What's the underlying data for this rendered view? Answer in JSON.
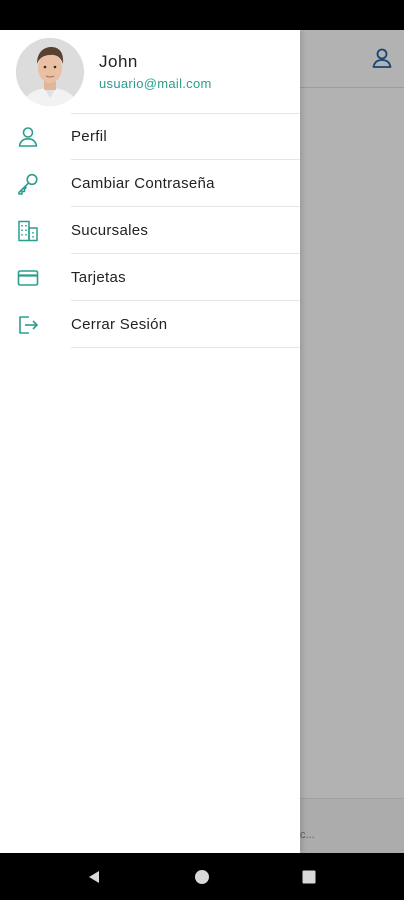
{
  "colors": {
    "accent": "#2a9d8f",
    "text": "#222222",
    "profile_icon": "#2563a8"
  },
  "user": {
    "name": "John",
    "email": "usuario@mail.com"
  },
  "menu": [
    {
      "label": "Perfil",
      "icon": "person-icon"
    },
    {
      "label": "Cambiar Contraseña",
      "icon": "key-icon"
    },
    {
      "label": "Sucursales",
      "icon": "building-icon"
    },
    {
      "label": "Tarjetas",
      "icon": "card-icon"
    },
    {
      "label": "Cerrar Sesión",
      "icon": "logout-icon"
    }
  ],
  "app": {
    "footer_text": "c..."
  },
  "nav": {
    "back_icon": "back-icon",
    "home_icon": "home-icon",
    "recents_icon": "recents-icon"
  }
}
